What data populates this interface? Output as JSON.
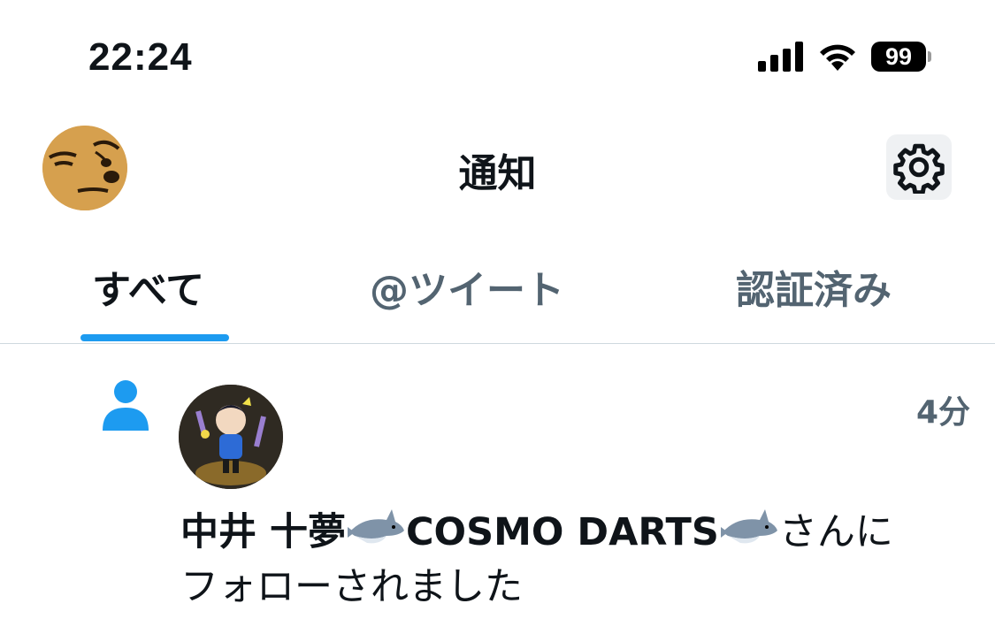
{
  "status_bar": {
    "time": "22:24",
    "battery": "99",
    "icons": [
      "signal-icon",
      "wifi-icon",
      "battery-icon"
    ]
  },
  "header": {
    "title": "通知",
    "avatar_icon": "avatar",
    "settings_icon": "gear-icon"
  },
  "tabs": [
    {
      "label": "すべて",
      "active": true
    },
    {
      "label": "@ツイート",
      "active": false
    },
    {
      "label": "認証済み",
      "active": false
    }
  ],
  "notification": {
    "icon": "person-icon",
    "time": "4分",
    "name_part1": "中井 十夢",
    "name_part2": "COSMO DARTS",
    "emoji": "shark-emoji",
    "suffix": "さんに",
    "line2": "フォローされました"
  },
  "colors": {
    "accent": "#1d9bf0",
    "text_primary": "#0f1419",
    "text_secondary": "#536471",
    "divider": "#cfd9de"
  }
}
